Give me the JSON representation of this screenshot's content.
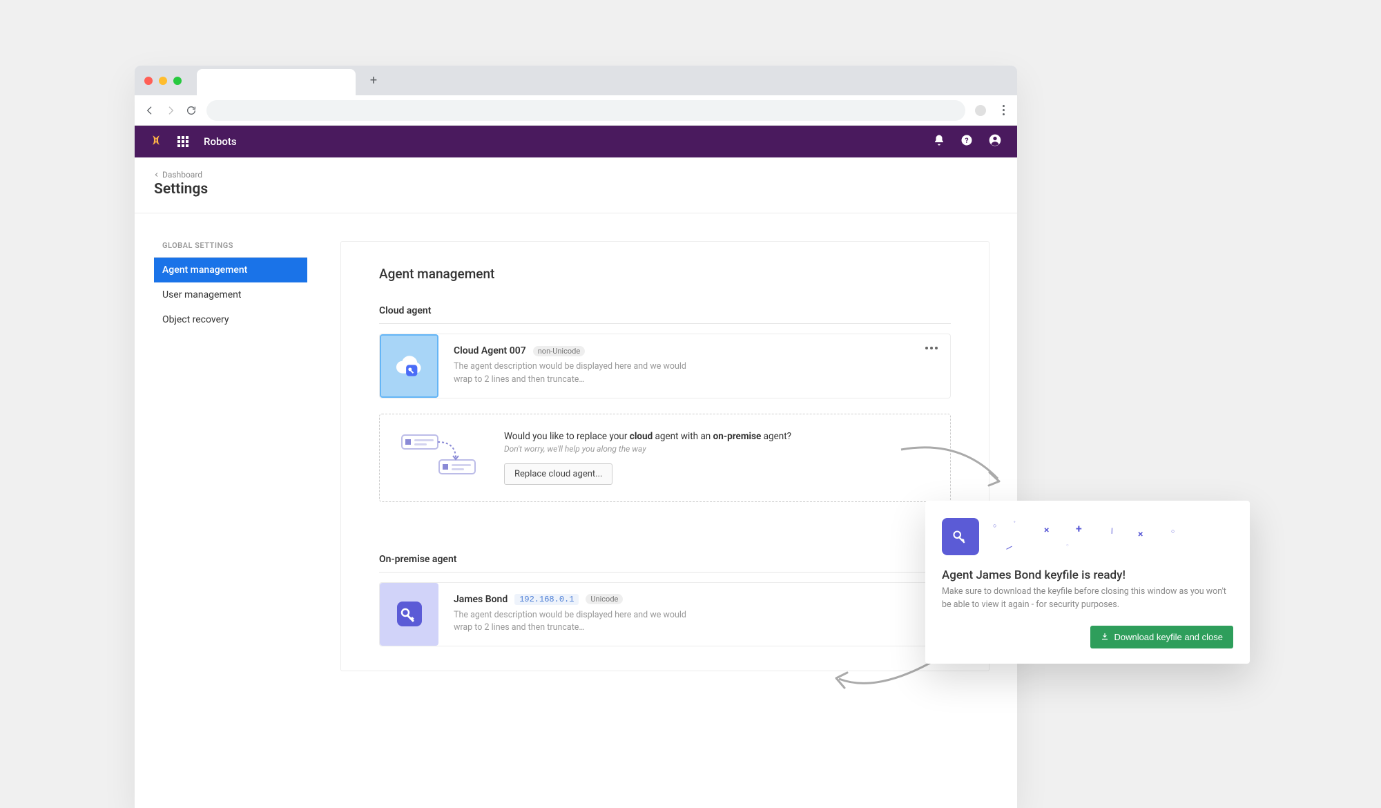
{
  "app": {
    "title": "Robots"
  },
  "breadcrumb": {
    "back": "Dashboard"
  },
  "page": {
    "title": "Settings"
  },
  "sidebar": {
    "heading": "GLOBAL SETTINGS",
    "items": [
      {
        "label": "Agent management",
        "active": true
      },
      {
        "label": "User management",
        "active": false
      },
      {
        "label": "Object recovery",
        "active": false
      }
    ]
  },
  "content": {
    "title": "Agent management",
    "cloud": {
      "section": "Cloud agent",
      "name": "Cloud Agent 007",
      "badge": "non-Unicode",
      "desc": "The agent description would be displayed here and we would wrap to 2 lines and then truncate…"
    },
    "replace": {
      "text_prefix": "Would you like to replace your ",
      "text_bold1": "cloud",
      "text_mid": " agent with an ",
      "text_bold2": "on-premise",
      "text_suffix": " agent?",
      "sub": "Don't worry, we'll help you along the way",
      "button": "Replace cloud agent..."
    },
    "prem": {
      "section": "On-premise agent",
      "name": "James Bond",
      "ip": "192.168.0.1",
      "badge": "Unicode",
      "desc": "The agent description would be displayed here and we would wrap to 2 lines and then truncate…"
    }
  },
  "popup": {
    "title": "Agent James Bond keyfile is ready!",
    "desc": "Make sure to download the keyfile before closing this window as you won't be able to view it again - for security purposes.",
    "button": "Download keyfile and close"
  }
}
